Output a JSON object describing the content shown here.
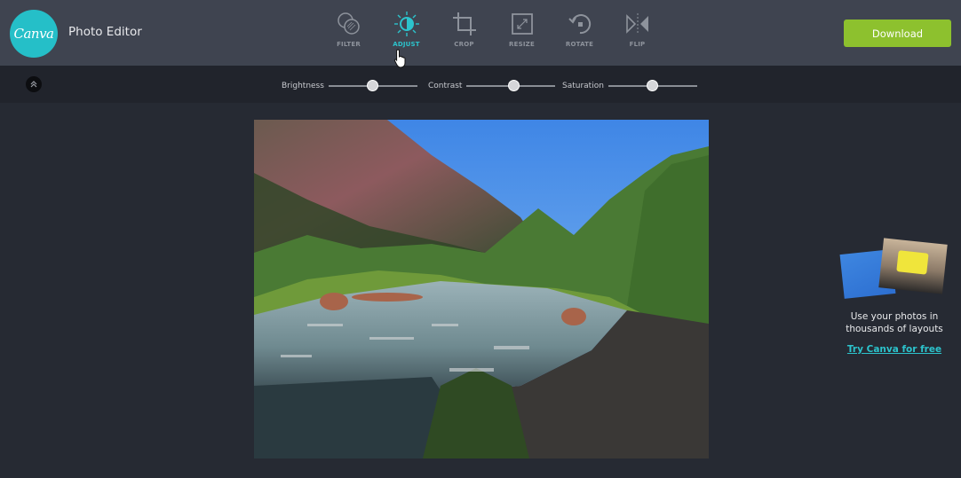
{
  "app": {
    "logo_text": "Canva",
    "title": "Photo Editor"
  },
  "toolbar": {
    "tools": [
      {
        "id": "filter",
        "label": "FILTER",
        "icon": "filter-icon",
        "active": false
      },
      {
        "id": "adjust",
        "label": "ADJUST",
        "icon": "adjust-icon",
        "active": true
      },
      {
        "id": "crop",
        "label": "CROP",
        "icon": "crop-icon",
        "active": false
      },
      {
        "id": "resize",
        "label": "RESIZE",
        "icon": "resize-icon",
        "active": false
      },
      {
        "id": "rotate",
        "label": "ROTATE",
        "icon": "rotate-icon",
        "active": false
      },
      {
        "id": "flip",
        "label": "FLIP",
        "icon": "flip-icon",
        "active": false
      }
    ],
    "download_label": "Download"
  },
  "adjust": {
    "collapse_icon": "chevron-up-icon",
    "sliders": [
      {
        "label": "Brightness",
        "value_percent": 50
      },
      {
        "label": "Contrast",
        "value_percent": 53
      },
      {
        "label": "Saturation",
        "value_percent": 50
      }
    ]
  },
  "canvas": {
    "image_description": "Mountain river with forested slope and blue sky"
  },
  "promo": {
    "text_line1": "Use your photos in",
    "text_line2": "thousands of layouts",
    "link": "Try Canva for free"
  },
  "colors": {
    "accent": "#2cc3cc",
    "download": "#8dc12e",
    "topbar": "#3f4450",
    "subbar": "#21242c",
    "background": "#262a33"
  }
}
